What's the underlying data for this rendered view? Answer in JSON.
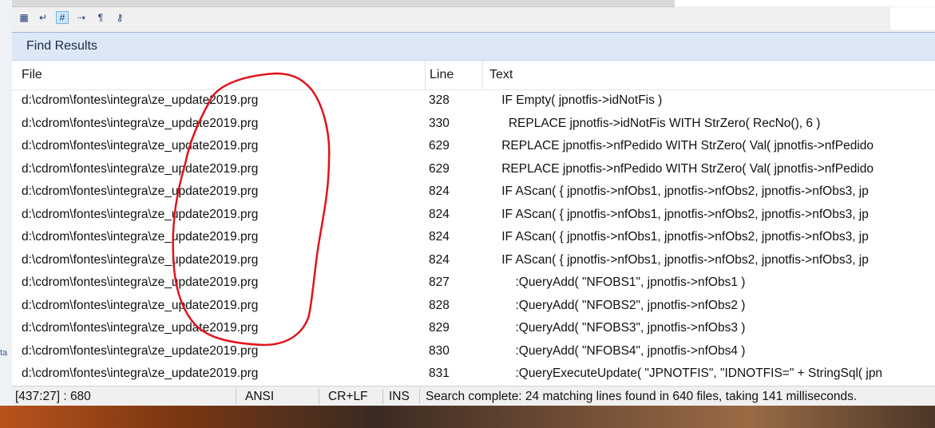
{
  "toolbar": {
    "buttons": [
      {
        "icon": "color-grid-icon",
        "glyph": "▦"
      },
      {
        "icon": "word-wrap-icon",
        "glyph": "↵"
      },
      {
        "icon": "hash-icon",
        "glyph": "#"
      },
      {
        "icon": "arrow-right-icon",
        "glyph": "⇢"
      },
      {
        "icon": "pilcrow-icon",
        "glyph": "¶"
      },
      {
        "icon": "key-icon",
        "glyph": "⚷"
      }
    ]
  },
  "find_results": {
    "title": "Find Results",
    "columns": {
      "file": "File",
      "line": "Line",
      "text": "Text"
    },
    "rows": [
      {
        "file": "d:\\cdrom\\fontes\\integra\\ze_update2019.prg",
        "line": "328",
        "text": "    IF Empty( jpnotfis->idNotFis )"
      },
      {
        "file": "d:\\cdrom\\fontes\\integra\\ze_update2019.prg",
        "line": "330",
        "text": "      REPLACE jpnotfis->idNotFis WITH StrZero( RecNo(), 6 )"
      },
      {
        "file": "d:\\cdrom\\fontes\\integra\\ze_update2019.prg",
        "line": "629",
        "text": "    REPLACE jpnotfis->nfPedido WITH StrZero( Val( jpnotfis->nfPedido"
      },
      {
        "file": "d:\\cdrom\\fontes\\integra\\ze_update2019.prg",
        "line": "629",
        "text": "    REPLACE jpnotfis->nfPedido WITH StrZero( Val( jpnotfis->nfPedido"
      },
      {
        "file": "d:\\cdrom\\fontes\\integra\\ze_update2019.prg",
        "line": "824",
        "text": "    IF AScan( { jpnotfis->nfObs1, jpnotfis->nfObs2, jpnotfis->nfObs3, jp"
      },
      {
        "file": "d:\\cdrom\\fontes\\integra\\ze_update2019.prg",
        "line": "824",
        "text": "    IF AScan( { jpnotfis->nfObs1, jpnotfis->nfObs2, jpnotfis->nfObs3, jp"
      },
      {
        "file": "d:\\cdrom\\fontes\\integra\\ze_update2019.prg",
        "line": "824",
        "text": "    IF AScan( { jpnotfis->nfObs1, jpnotfis->nfObs2, jpnotfis->nfObs3, jp"
      },
      {
        "file": "d:\\cdrom\\fontes\\integra\\ze_update2019.prg",
        "line": "824",
        "text": "    IF AScan( { jpnotfis->nfObs1, jpnotfis->nfObs2, jpnotfis->nfObs3, jp"
      },
      {
        "file": "d:\\cdrom\\fontes\\integra\\ze_update2019.prg",
        "line": "827",
        "text": "        :QueryAdd( \"NFOBS1\", jpnotfis->nfObs1 )"
      },
      {
        "file": "d:\\cdrom\\fontes\\integra\\ze_update2019.prg",
        "line": "828",
        "text": "        :QueryAdd( \"NFOBS2\", jpnotfis->nfObs2 )"
      },
      {
        "file": "d:\\cdrom\\fontes\\integra\\ze_update2019.prg",
        "line": "829",
        "text": "        :QueryAdd( \"NFOBS3\", jpnotfis->nfObs3 )"
      },
      {
        "file": "d:\\cdrom\\fontes\\integra\\ze_update2019.prg",
        "line": "830",
        "text": "        :QueryAdd( \"NFOBS4\", jpnotfis->nfObs4 )"
      },
      {
        "file": "d:\\cdrom\\fontes\\integra\\ze_update2019.prg",
        "line": "831",
        "text": "        :QueryExecuteUpdate( \"JPNOTFIS\", \"IDNOTFIS=\" + StringSql( jpn"
      }
    ]
  },
  "status": {
    "position": "[437:27] : 680",
    "encoding": "ANSI",
    "line_endings": "CR+LF",
    "mode": "INS",
    "message": "Search complete: 24 matching lines found in 640 files, taking 141 milliseconds."
  },
  "desktop": {
    "partial_text": "ta"
  },
  "colors": {
    "annotation": "#e0141c",
    "panel_header": "#dce8f5"
  }
}
